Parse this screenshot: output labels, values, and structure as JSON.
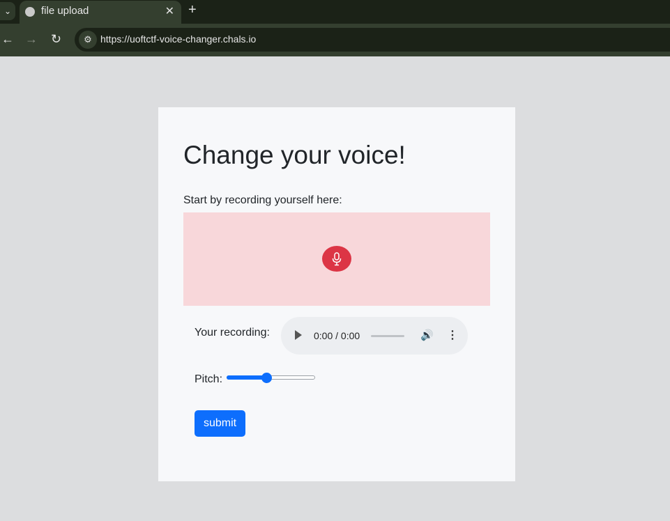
{
  "browser": {
    "tab_title": "file upload",
    "url": "https://uoftctf-voice-changer.chals.io",
    "new_tab_label": "+",
    "close_tab_label": "✕",
    "tab_menu_label": "⌄",
    "back_label": "←",
    "forward_label": "→",
    "reload_label": "↻",
    "site_info_label": "⚙"
  },
  "page": {
    "heading": "Change your voice!",
    "record_prompt": "Start by recording yourself here:",
    "recording_label": "Your recording:",
    "audio_time": "0:00 / 0:00",
    "volume_label": "🔊",
    "more_label": "⋮",
    "pitch_label": "Pitch:",
    "pitch_value": 0.45,
    "submit_label": "submit"
  },
  "colors": {
    "record_area": "#f8d7da",
    "mic_button": "#dc3545",
    "accent": "#0d6efd"
  },
  "icons": {
    "mic": "microphone-icon",
    "globe": "globe-icon"
  }
}
